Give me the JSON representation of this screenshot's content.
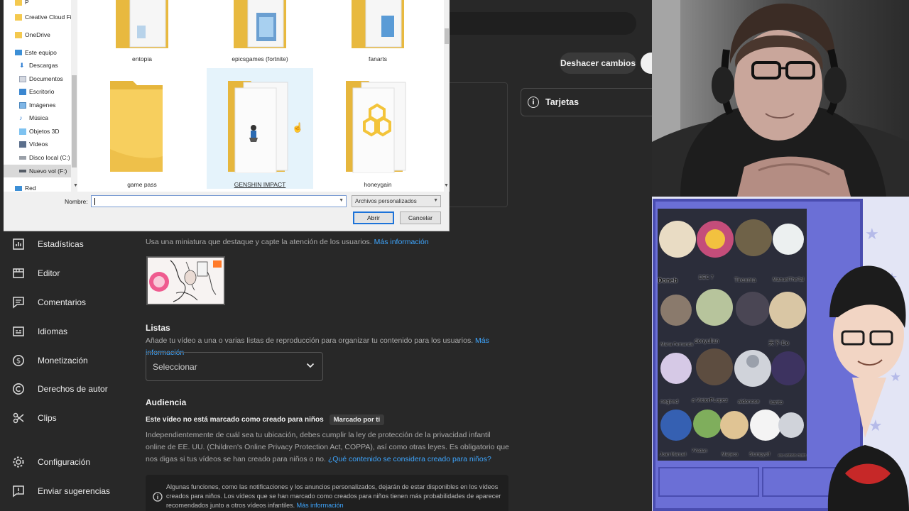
{
  "studio": {
    "undo_button": "Deshacer cambios",
    "cards_label": "Tarjetas",
    "sidebar": [
      {
        "label": "Estadísticas",
        "icon": "stats-icon"
      },
      {
        "label": "Editor",
        "icon": "editor-icon"
      },
      {
        "label": "Comentarios",
        "icon": "comments-icon"
      },
      {
        "label": "Idiomas",
        "icon": "subtitles-icon"
      },
      {
        "label": "Monetización",
        "icon": "dollar-icon"
      },
      {
        "label": "Derechos de autor",
        "icon": "copyright-icon"
      },
      {
        "label": "Clips",
        "icon": "scissors-icon"
      },
      {
        "label": "Configuración",
        "icon": "gear-icon"
      },
      {
        "label": "Enviar sugerencias",
        "icon": "feedback-icon"
      }
    ],
    "thumbnail": {
      "desc": "Usa una miniatura que destaque y capte la atención de los usuarios.",
      "link": "Más información"
    },
    "playlists": {
      "title": "Listas",
      "desc": "Añade tu vídeo a una o varias listas de reproducción para organizar tu contenido para los usuarios.",
      "link": "Más información",
      "select_label": "Seleccionar"
    },
    "audience": {
      "title": "Audiencia",
      "status": "Este vídeo no está marcado como creado para niños",
      "chip": "Marcado por ti",
      "desc": "Independientemente de cuál sea tu ubicación, debes cumplir la ley de protección de la privacidad infantil online de EE. UU. (Children's Online Privacy Protection Act, COPPA), así como otras leyes. Es obligatorio que nos digas si tus vídeos se han creado para niños o no.",
      "link": "¿Qué contenido se considera creado para niños?",
      "info": "Algunas funciones, como las notificaciones y los anuncios personalizados, dejarán de estar disponibles en los vídeos creados para niños. Los vídeos que se han marcado como creados para niños tienen más probabilidades de aparecer recomendados junto a otros vídeos infantiles.",
      "info_link": "Más información"
    }
  },
  "dialog": {
    "tree": [
      {
        "label": "P",
        "icon": "folder-icon",
        "indent": 1
      },
      {
        "label": "Creative Cloud Fil",
        "icon": "folder-icon",
        "indent": 1
      },
      {
        "label": "OneDrive",
        "icon": "folder-icon",
        "indent": 1
      },
      {
        "label": "Este equipo",
        "icon": "computer-icon",
        "indent": 0
      },
      {
        "label": "Descargas",
        "icon": "download-icon",
        "indent": 1
      },
      {
        "label": "Documentos",
        "icon": "documents-icon",
        "indent": 1
      },
      {
        "label": "Escritorio",
        "icon": "desktop-icon",
        "indent": 1
      },
      {
        "label": "Imágenes",
        "icon": "pictures-icon",
        "indent": 1
      },
      {
        "label": "Música",
        "icon": "music-icon",
        "indent": 1
      },
      {
        "label": "Objetos 3D",
        "icon": "objects3d-icon",
        "indent": 1
      },
      {
        "label": "Vídeos",
        "icon": "videos-icon",
        "indent": 1
      },
      {
        "label": "Disco local (C:)",
        "icon": "drive-icon",
        "indent": 1
      },
      {
        "label": "Nuevo vol (F:)",
        "icon": "drive-icon",
        "indent": 1,
        "selected": true
      },
      {
        "label": "Red",
        "icon": "network-icon",
        "indent": 0
      }
    ],
    "folders": [
      {
        "label": "entopia"
      },
      {
        "label": "epicsgames (fortnite)"
      },
      {
        "label": "fanarts"
      },
      {
        "label": "game pass"
      },
      {
        "label": "GENSHIN IMPACT",
        "selected": true
      },
      {
        "label": "honeygain"
      }
    ],
    "name_label": "Nombre:",
    "name_value": "",
    "file_type": "Archivos personalizados",
    "open_button": "Abrir",
    "cancel_button": "Cancelar"
  },
  "overlay": {
    "viewers": [
      "Doneb",
      "DEC 7",
      "Tirexma",
      "ManuelTheTal",
      "Maria Fernanda",
      "donyullan",
      "天下-Do",
      "negired",
      "a VictorPLopez",
      "aldonose",
      "karito",
      "Joan Manuel",
      "77edan",
      "Marjeco",
      "Stumpyoff",
      "esc antonio matin"
    ]
  }
}
